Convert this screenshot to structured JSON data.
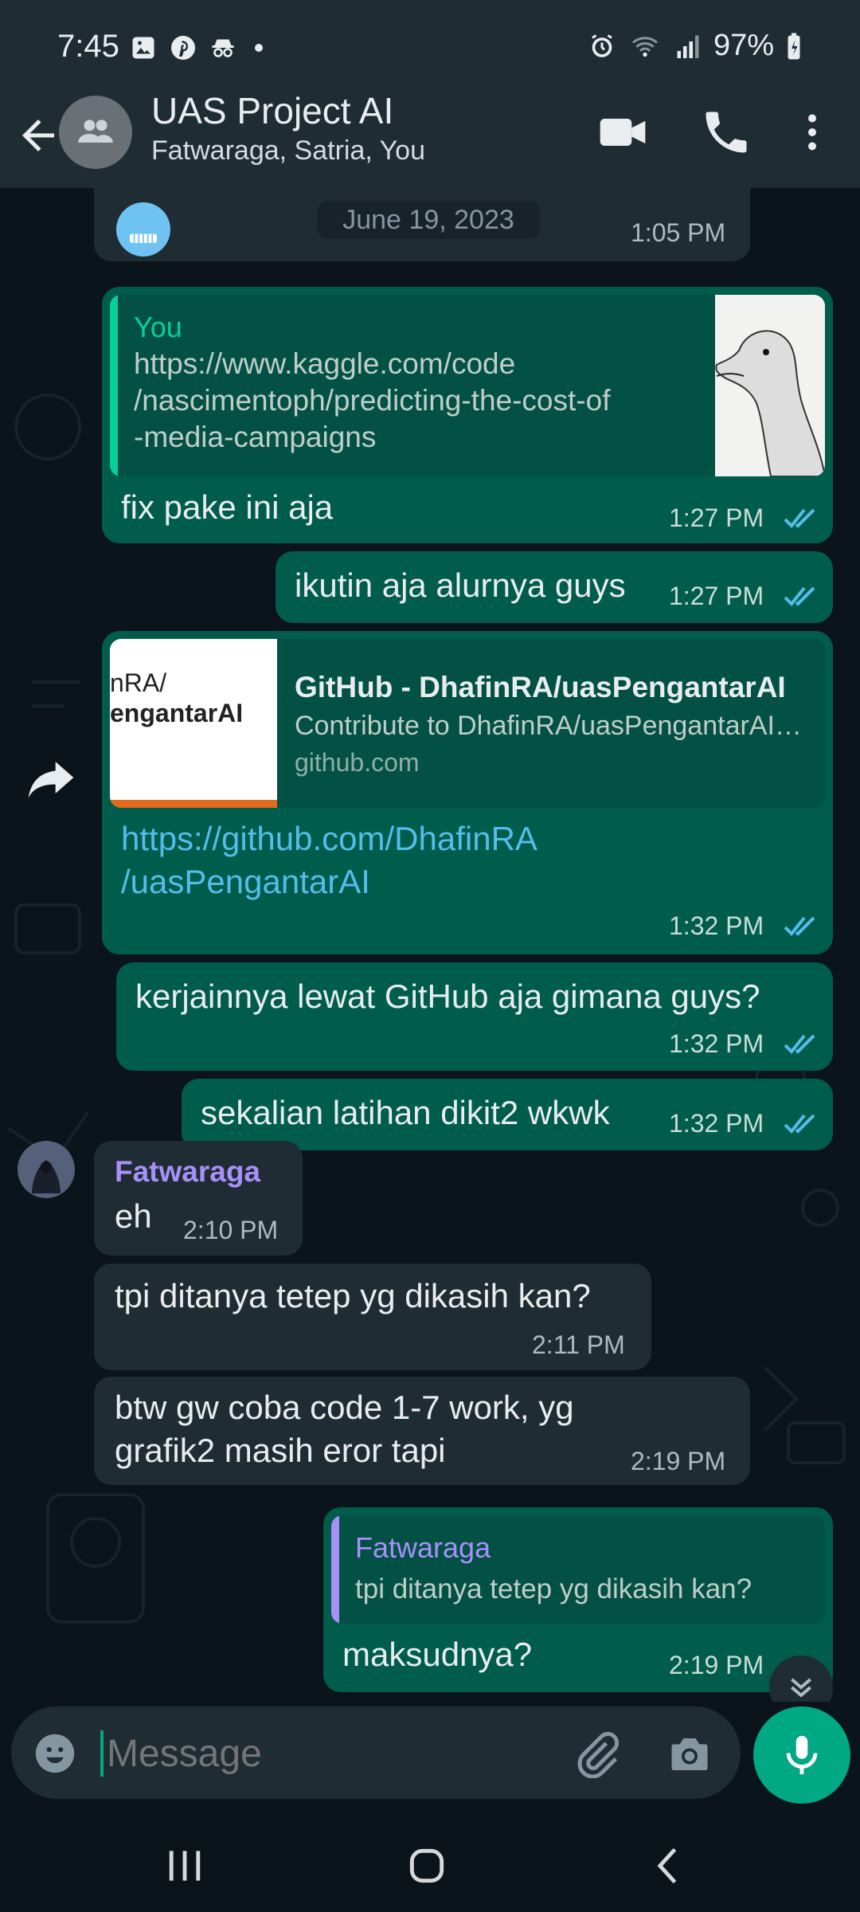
{
  "status_bar": {
    "time": "7:45",
    "battery": "97%"
  },
  "header": {
    "title": "UAS Project AI",
    "subtitle": "Fatwaraga, Satria, You"
  },
  "chat": {
    "date_chip": "June 19, 2023",
    "first_time": "1:05 PM",
    "m1": {
      "quote_author": "You",
      "quote_text_1": "https://www.kaggle.com/code",
      "quote_text_2": "/nascimentoph/predicting-the-cost-of",
      "quote_text_3": "-media-campaigns",
      "text": "fix pake ini aja",
      "time": "1:27 PM"
    },
    "m2": {
      "text": "ikutin aja alurnya guys",
      "time": "1:27 PM"
    },
    "m3": {
      "thumb_text_1": "nRA/",
      "thumb_text_2": "engantarAI",
      "preview_title": "GitHub - DhafinRA/uasPengantarAI",
      "preview_desc": "Contribute to DhafinRA/uasPengantarAI…",
      "preview_domain": "github.com",
      "link_1": "https://github.com/DhafinRA",
      "link_2": "/uasPengantarAI",
      "time": "1:32 PM"
    },
    "m4": {
      "text": "kerjainnya lewat GitHub aja gimana guys?",
      "time": "1:32 PM"
    },
    "m5": {
      "text": "sekalian latihan dikit2 wkwk",
      "time": "1:32 PM"
    },
    "m6": {
      "sender": "Fatwaraga",
      "text": "eh",
      "time": "2:10 PM"
    },
    "m7": {
      "text": "tpi ditanya tetep yg dikasih kan?",
      "time": "2:11 PM"
    },
    "m8": {
      "text_1": "btw gw coba code 1-7 work, yg",
      "text_2": "grafik2 masih eror tapi",
      "time": "2:19 PM"
    },
    "m9": {
      "quote_author": "Fatwaraga",
      "quote_text": "tpi ditanya tetep yg dikasih kan?",
      "text": "maksudnya?",
      "time": "2:19 PM"
    }
  },
  "composer": {
    "placeholder": "Message"
  },
  "colors": {
    "accent": "#00a884",
    "outgoing": "#005c4b",
    "incoming": "#202c33",
    "fatwaraga": "#a791f8",
    "you_quote": "#06cf9c",
    "link": "#53bdeb",
    "ticks": "#53bdeb"
  }
}
